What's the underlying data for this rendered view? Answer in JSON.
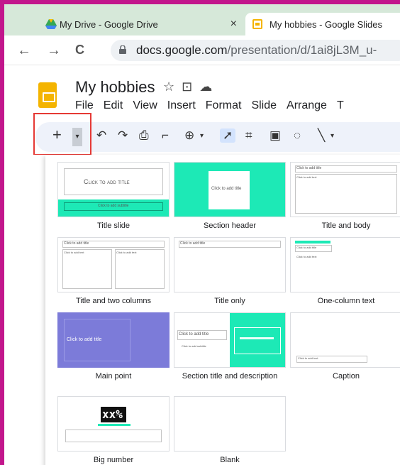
{
  "tabs": [
    {
      "label": "My Drive - Google Drive",
      "close": "×"
    },
    {
      "label": "My hobbies - Google Slides"
    }
  ],
  "address": {
    "host": "docs.google.com",
    "path": "/presentation/d/1ai8jL3M_u-"
  },
  "nav": {
    "back": "←",
    "forward": "→",
    "reload": "C"
  },
  "document": {
    "title": "My hobbies",
    "menu": [
      "File",
      "Edit",
      "View",
      "Insert",
      "Format",
      "Slide",
      "Arrange",
      "T"
    ]
  },
  "toolbar": {
    "new_slide": "+",
    "new_slide_caret": "▾"
  },
  "layouts": [
    {
      "name": "Title slide",
      "thumb_text": "Click to add title",
      "thumb_sub": "Click to add subtitle"
    },
    {
      "name": "Section header",
      "thumb_text": "Click to add title"
    },
    {
      "name": "Title and body",
      "thumb_text": "Click to add title",
      "thumb_sub": "Click to add text"
    },
    {
      "name": "Title and two columns",
      "thumb_text": "Click to add title",
      "thumb_sub": "Click to add text"
    },
    {
      "name": "Title only",
      "thumb_text": "Click to add title"
    },
    {
      "name": "One-column text",
      "thumb_text": "Click to add title",
      "thumb_sub": "Click to add text"
    },
    {
      "name": "Main point",
      "thumb_text": "Click to add title"
    },
    {
      "name": "Section title and description",
      "thumb_text": "Click to add title",
      "thumb_sub": "Click to add subtitle"
    },
    {
      "name": "Caption",
      "thumb_text": "Click to add text"
    },
    {
      "name": "Big number",
      "thumb_text": "xx%"
    },
    {
      "name": "Blank",
      "thumb_text": ""
    }
  ],
  "colors": {
    "accent_teal": "#1de9b6",
    "main_point": "#7c7bd9",
    "slides_yellow": "#f4b400",
    "highlight_red": "#e53935",
    "frame_magenta": "#c2168c"
  }
}
